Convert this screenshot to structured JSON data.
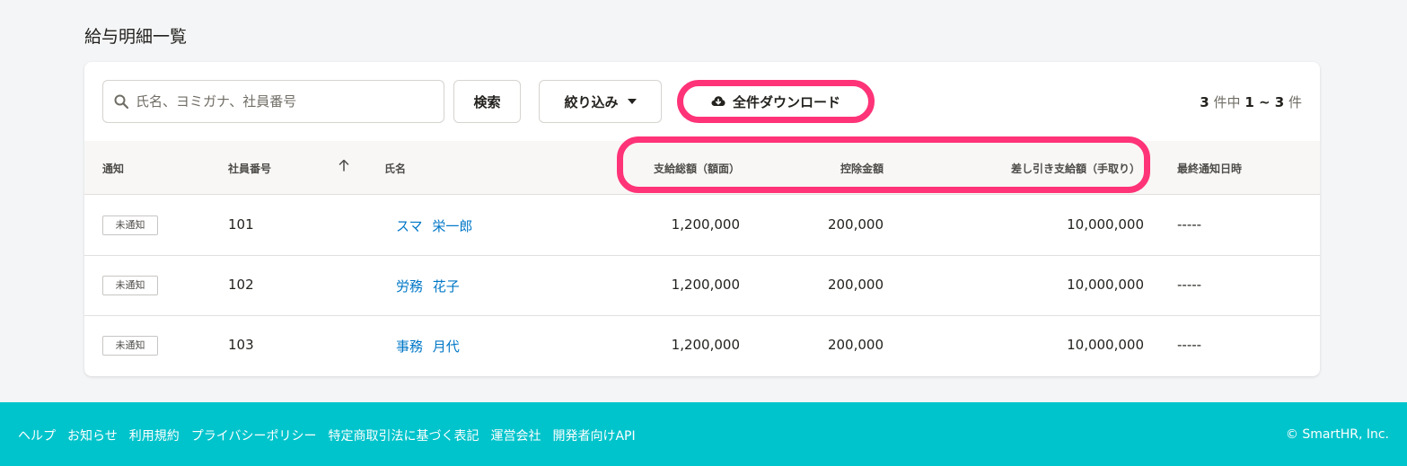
{
  "page": {
    "title": "給与明細一覧"
  },
  "toolbar": {
    "search_placeholder": "氏名、ヨミガナ、社員番号",
    "search_button": "検索",
    "filter_button": "絞り込み",
    "download_button": "全件ダウンロード",
    "count_total": "3",
    "count_mid": "件中",
    "count_range": "1 ~ 3",
    "count_unit": "件"
  },
  "table": {
    "headers": {
      "notification": "通知",
      "employee_no": "社員番号",
      "name": "氏名",
      "gross": "支給総額（額面）",
      "deduction": "控除金額",
      "net": "差し引き支給額（手取り）",
      "last_notified": "最終通知日時"
    },
    "rows": [
      {
        "status": "未通知",
        "employee_no": "101",
        "name": "スマ 栄一郎",
        "gross": "1,200,000",
        "deduction": "200,000",
        "net": "10,000,000",
        "last_notified": "-----"
      },
      {
        "status": "未通知",
        "employee_no": "102",
        "name": "労務 花子",
        "gross": "1,200,000",
        "deduction": "200,000",
        "net": "10,000,000",
        "last_notified": "-----"
      },
      {
        "status": "未通知",
        "employee_no": "103",
        "name": "事務 月代",
        "gross": "1,200,000",
        "deduction": "200,000",
        "net": "10,000,000",
        "last_notified": "-----"
      }
    ]
  },
  "footer": {
    "links": [
      "ヘルプ",
      "お知らせ",
      "利用規約",
      "プライバシーポリシー",
      "特定商取引法に基づく表記",
      "運営会社",
      "開発者向けAPI"
    ],
    "copyright": "© SmartHR, Inc."
  },
  "colors": {
    "accent_link": "#0077c7",
    "highlight": "#ff3377",
    "footer_bg": "#00c4cc"
  },
  "icons": {
    "search": "search-icon",
    "cloud": "cloud-download-icon",
    "sort": "arrow-up-icon",
    "caret": "caret-down-icon"
  }
}
